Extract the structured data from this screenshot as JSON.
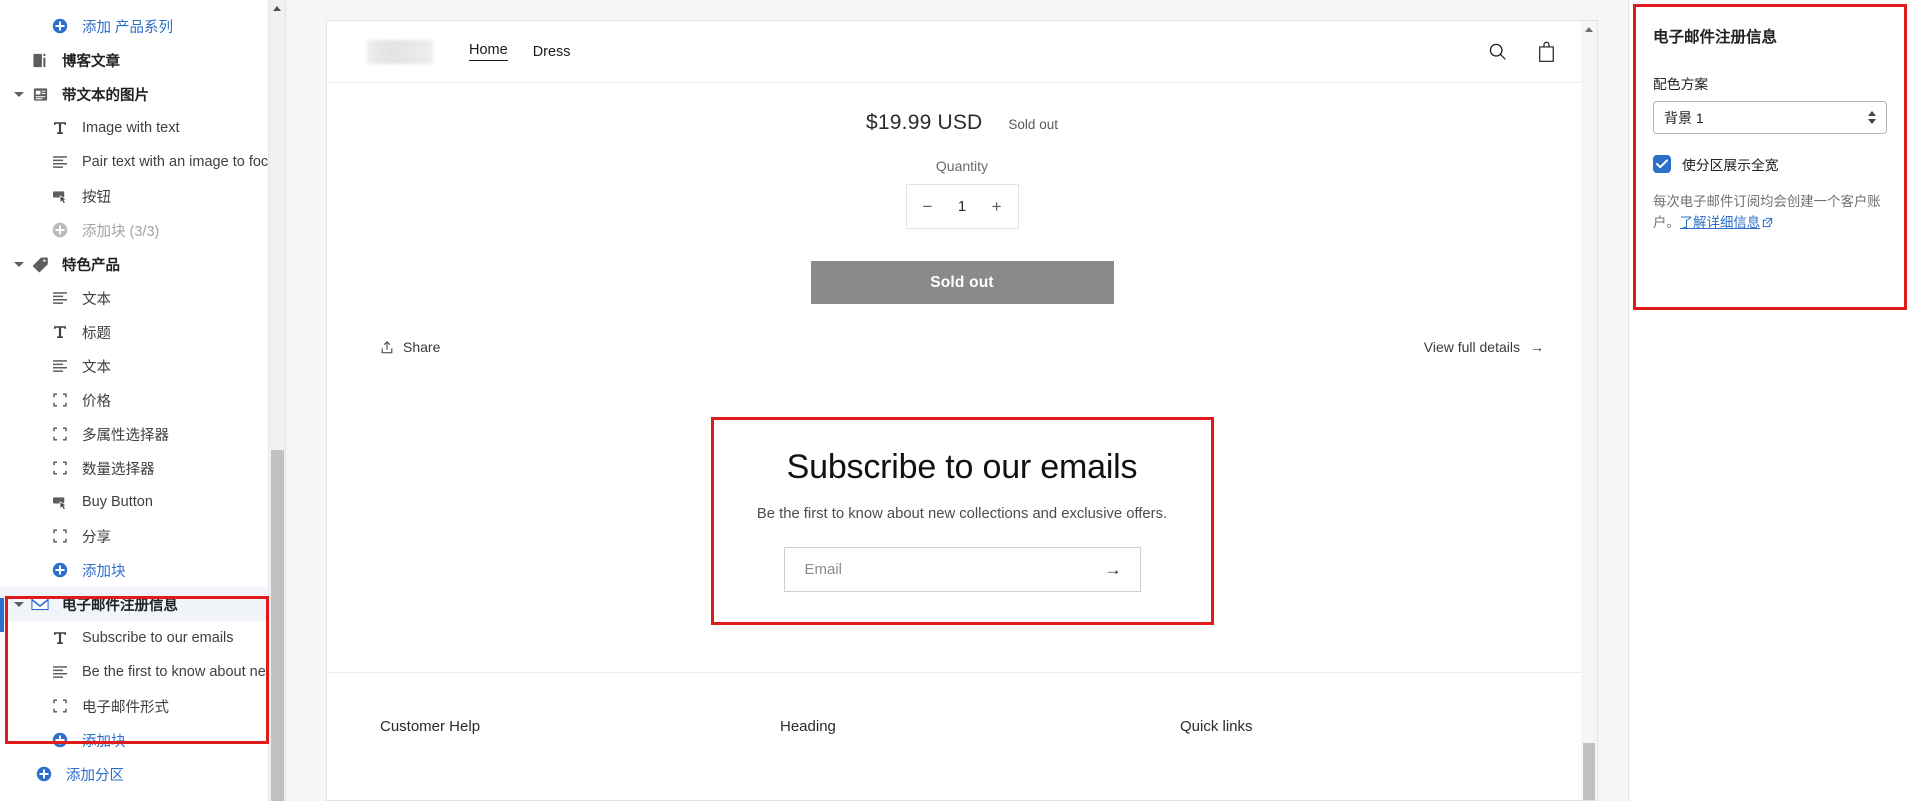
{
  "sidebar": {
    "items": [
      {
        "label": "添加 产品系列",
        "type": "addblock",
        "icon": "plus-circle-icon",
        "indent": "add",
        "dim": false
      },
      {
        "label": "博客文章",
        "type": "section",
        "icon": "blog-post-icon",
        "caret": false
      },
      {
        "label": "带文本的图片",
        "type": "section",
        "icon": "image-with-text-icon",
        "caret": true
      },
      {
        "label": "Image with text",
        "type": "block",
        "icon": "heading-icon"
      },
      {
        "label": "Pair text with an image to foc...",
        "type": "block",
        "icon": "text-icon"
      },
      {
        "label": "按钮",
        "type": "block",
        "icon": "button-icon"
      },
      {
        "label": "添加块 (3/3)",
        "type": "addblock",
        "icon": "plus-circle-icon",
        "dim": true
      },
      {
        "label": "特色产品",
        "type": "section",
        "icon": "tag-icon",
        "caret": true
      },
      {
        "label": "文本",
        "type": "block",
        "icon": "text-icon"
      },
      {
        "label": "标题",
        "type": "block",
        "icon": "heading-icon"
      },
      {
        "label": "文本",
        "type": "block",
        "icon": "text-icon"
      },
      {
        "label": "价格",
        "type": "block",
        "icon": "generic-block-icon"
      },
      {
        "label": "多属性选择器",
        "type": "block",
        "icon": "generic-block-icon"
      },
      {
        "label": "数量选择器",
        "type": "block",
        "icon": "generic-block-icon"
      },
      {
        "label": "Buy Button",
        "type": "block",
        "icon": "button-icon"
      },
      {
        "label": "分享",
        "type": "block",
        "icon": "generic-block-icon"
      },
      {
        "label": "添加块",
        "type": "addblock",
        "icon": "plus-circle-icon",
        "dim": false
      },
      {
        "label": "电子邮件注册信息",
        "type": "section",
        "icon": "envelope-icon",
        "caret": true,
        "selected": true
      },
      {
        "label": "Subscribe to our emails",
        "type": "block",
        "icon": "heading-icon"
      },
      {
        "label": "Be the first to know about ne...",
        "type": "block",
        "icon": "text-icon"
      },
      {
        "label": "电子邮件形式",
        "type": "block",
        "icon": "generic-block-icon"
      },
      {
        "label": "添加块",
        "type": "addblock",
        "icon": "plus-circle-icon",
        "dim": false
      },
      {
        "label": "添加分区",
        "type": "addsection",
        "icon": "plus-circle-icon"
      }
    ]
  },
  "preview": {
    "header": {
      "nav": [
        {
          "label": "Home",
          "active": true
        },
        {
          "label": "Dress",
          "active": false
        }
      ],
      "search_icon": "search-icon",
      "cart_icon": "cart-icon"
    },
    "product": {
      "price": "$19.99 USD",
      "availability": "Sold out",
      "quantity_label": "Quantity",
      "quantity_value": "1",
      "minus": "−",
      "plus": "+",
      "buy_button": "Sold out",
      "share_label": "Share",
      "view_details": "View full details",
      "view_details_arrow": "→"
    },
    "newsletter": {
      "title": "Subscribe to our emails",
      "subtitle": "Be the first to know about new collections and exclusive offers.",
      "email_placeholder": "Email",
      "email_value": "",
      "submit_arrow": "→"
    },
    "footer": {
      "columns": [
        {
          "heading": "Customer Help"
        },
        {
          "heading": "Heading"
        },
        {
          "heading": "Quick links"
        }
      ]
    }
  },
  "right_panel": {
    "title": "电子邮件注册信息",
    "color_scheme_label": "配色方案",
    "color_scheme_value": "背景 1",
    "full_width_label": "使分区展示全宽",
    "full_width_checked": true,
    "note_text": "每次电子邮件订阅均会创建一个客户账户。",
    "note_link": "了解详细信息"
  },
  "colors": {
    "accent_blue": "#2c6ecb",
    "highlight_red": "#e01b1b",
    "soldout_gray": "#8a8a8a",
    "selected_row_bg": "#f1f5f9"
  }
}
